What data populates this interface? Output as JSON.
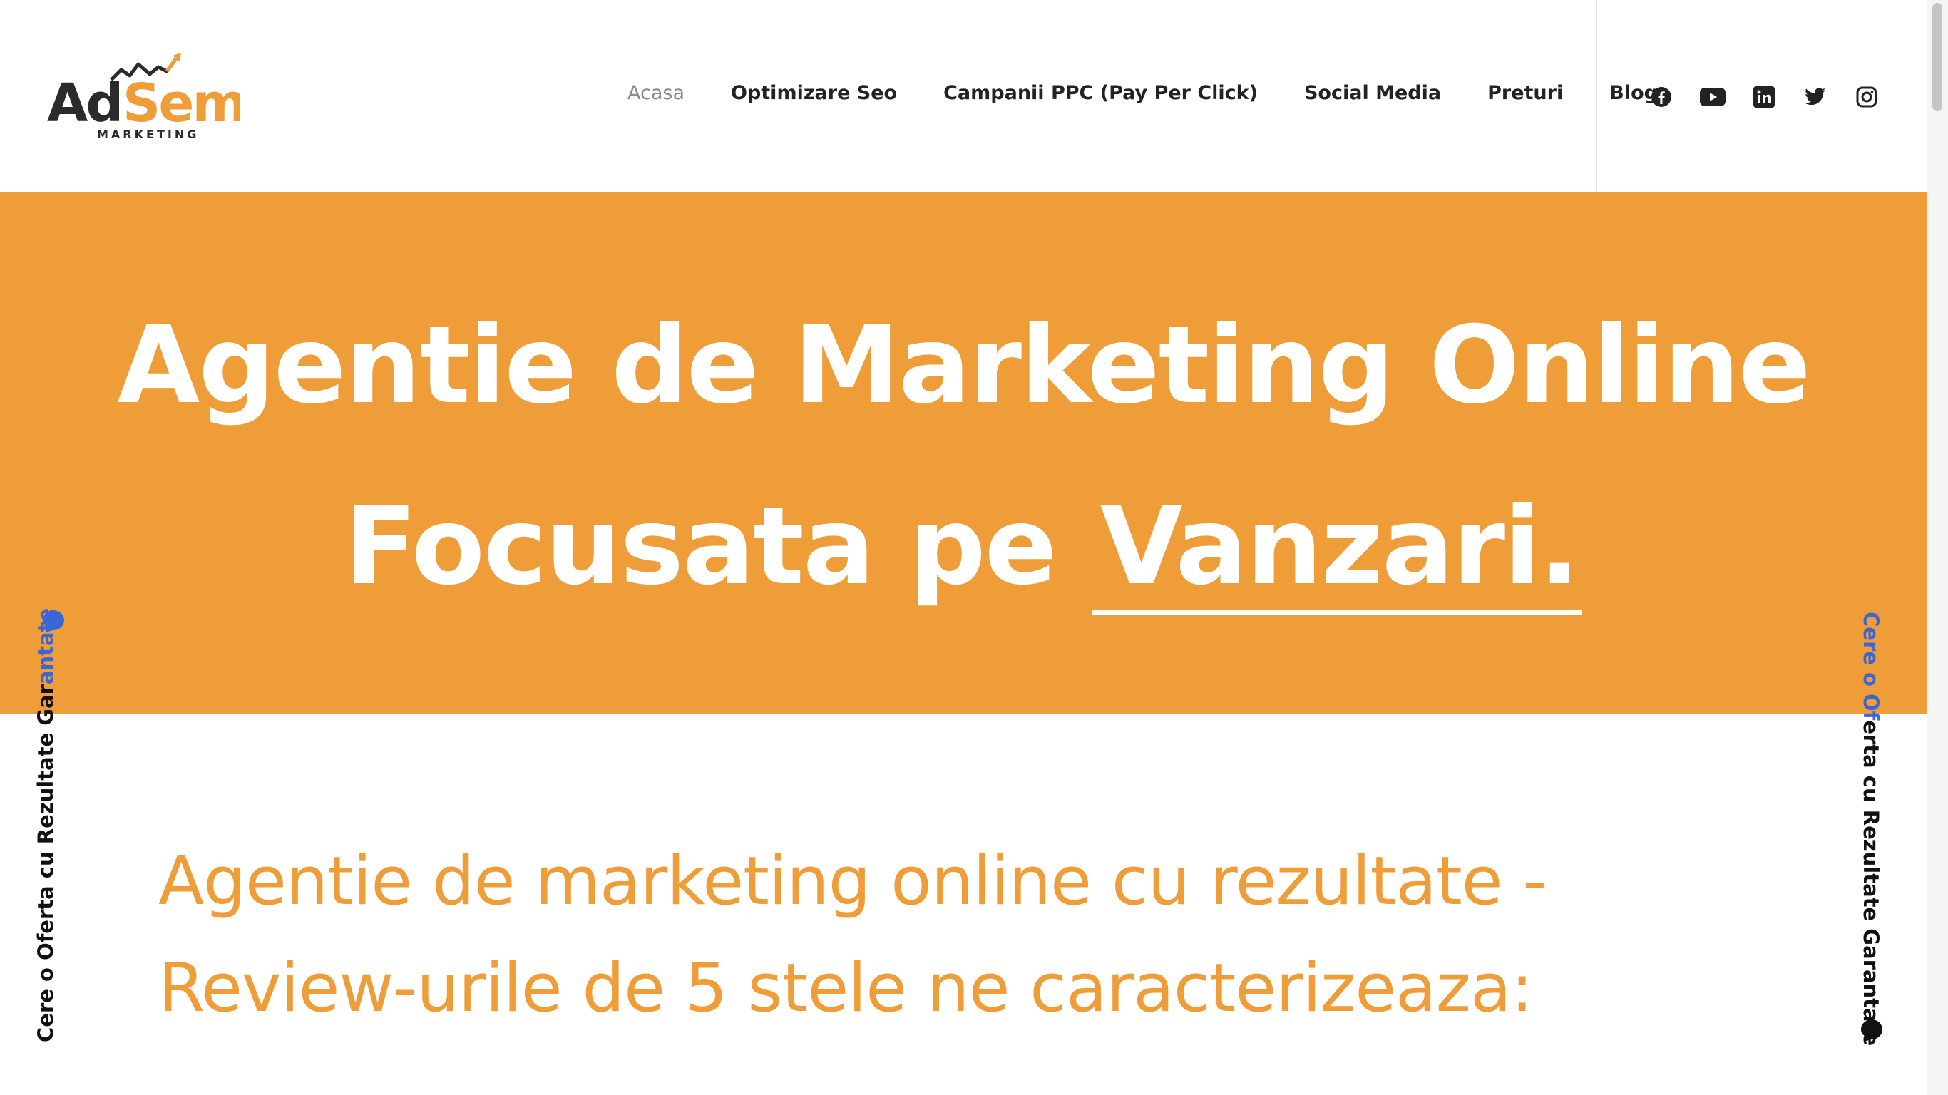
{
  "header": {
    "logo": {
      "name": "AdSem",
      "part1": "Ad",
      "part2": "Sem",
      "tagline": "MARKETING",
      "colors": {
        "dark": "#2b2b2b",
        "orange": "#ef9d38"
      }
    },
    "nav": [
      {
        "label": "Acasa",
        "active": true
      },
      {
        "label": "Optimizare Seo",
        "active": false
      },
      {
        "label": "Campanii PPC (Pay Per Click)",
        "active": false
      },
      {
        "label": "Social Media",
        "active": false
      },
      {
        "label": "Preturi",
        "active": false
      },
      {
        "label": "Blog",
        "active": false
      }
    ],
    "socials": [
      "facebook-icon",
      "youtube-icon",
      "linkedin-icon",
      "twitter-icon",
      "instagram-icon"
    ]
  },
  "hero": {
    "line1": "Agentie de Marketing Online",
    "line2_prefix": "Focusata pe",
    "line2_highlight": "Vanzari.",
    "background": "#ef9d38"
  },
  "section": {
    "heading_line1": "Agentie de marketing online cu rezultate -",
    "heading_line2": "Review-urile de 5 stele ne caracterizeaza:",
    "color": "#ef9d38"
  },
  "side_tabs": {
    "left": {
      "black_part": "Cere o Oferta cu Rezultate Gar",
      "blue_part": "antate"
    },
    "right": {
      "blue_part": "Cere o Of",
      "black_part": "erta cu Rezultate Garantate"
    },
    "accent": "#3b66d6"
  }
}
